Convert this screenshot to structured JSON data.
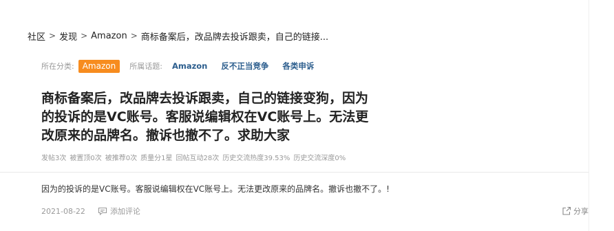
{
  "breadcrumb": {
    "items": [
      "社区",
      "发现",
      "Amazon",
      "商标备案后，改品牌去投诉跟卖，自己的链接..."
    ]
  },
  "meta": {
    "category_label": "所在分类:",
    "category_value": "Amazon",
    "topics_label": "所属话题:",
    "topics": [
      "Amazon",
      "反不正当竞争",
      "各类申诉"
    ]
  },
  "post": {
    "title_lines": [
      "商标备案后，改品牌去投诉跟卖，自己的链接变狗，因为",
      "的投诉的是VC账号。客服说编辑权在VC账号上。无法更",
      "改原来的品牌名。撤诉也撤不了。求助大家"
    ],
    "stats": [
      "发帖3次",
      "被置顶0次",
      "被推荐0次",
      "质量分1星",
      "回帖互动28次",
      "历史交流热度39.53%",
      "历史交流深度0%"
    ],
    "body": "因为的投诉的是VC账号。客服说编辑权在VC账号上。无法更改原来的品牌名。撤诉也撤不了。!"
  },
  "footer": {
    "date": "2021-08-22",
    "comment_label": "添加评论",
    "share_label": "分享"
  },
  "colors": {
    "category_tag": "#f78c1e",
    "topic_link": "#2b5d8d"
  }
}
